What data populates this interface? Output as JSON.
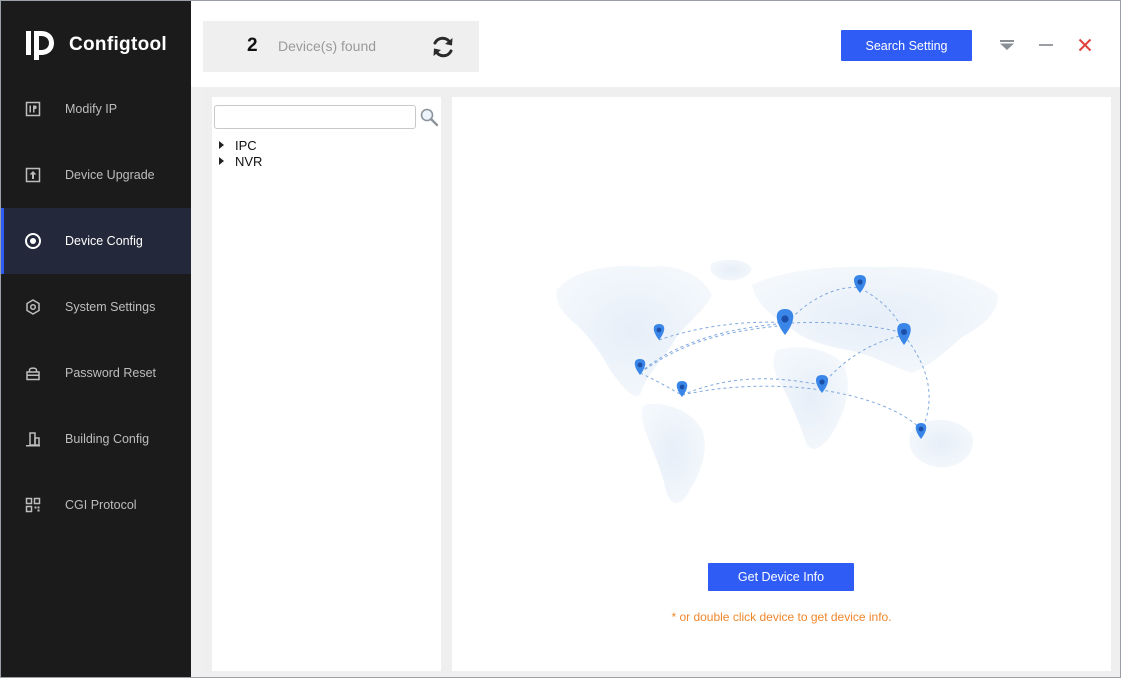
{
  "app": {
    "name": "Configtool"
  },
  "sidebar": {
    "items": [
      {
        "label": "Modify IP",
        "icon": "ip-icon",
        "active": false
      },
      {
        "label": "Device Upgrade",
        "icon": "upgrade-icon",
        "active": false
      },
      {
        "label": "Device Config",
        "icon": "target-icon",
        "active": true
      },
      {
        "label": "System Settings",
        "icon": "hex-gear-icon",
        "active": false
      },
      {
        "label": "Password Reset",
        "icon": "lock-icon",
        "active": false
      },
      {
        "label": "Building Config",
        "icon": "building-icon",
        "active": false
      },
      {
        "label": "CGI Protocol",
        "icon": "grid-icon",
        "active": false
      }
    ]
  },
  "header": {
    "device_count": "2",
    "device_count_label": "Device(s) found",
    "search_setting_label": "Search Setting"
  },
  "device_tree": {
    "search_placeholder": "",
    "items": [
      "IPC",
      "NVR"
    ]
  },
  "detail": {
    "get_info_label": "Get Device Info",
    "hint": "* or double click device to get device info."
  },
  "colors": {
    "accent": "#2f5cf5",
    "sidebar_bg": "#1b1b1b",
    "hint": "#f0862b",
    "close": "#e0433b"
  }
}
